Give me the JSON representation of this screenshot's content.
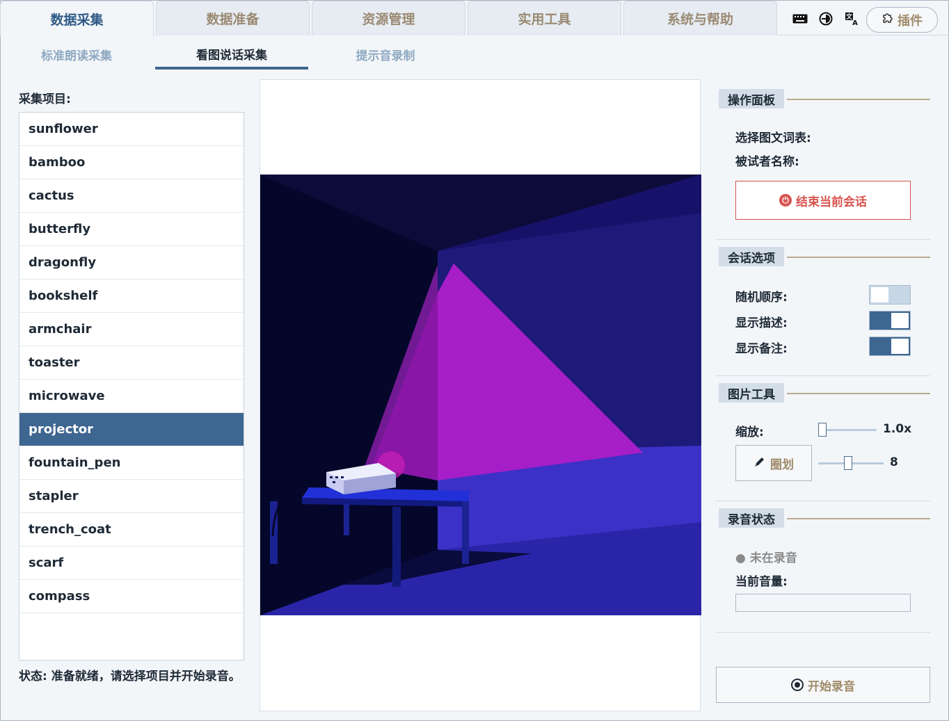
{
  "tabs": [
    {
      "label": "数据采集",
      "active": true
    },
    {
      "label": "数据准备",
      "active": false
    },
    {
      "label": "资源管理",
      "active": false
    },
    {
      "label": "实用工具",
      "active": false
    },
    {
      "label": "系统与帮助",
      "active": false
    }
  ],
  "toolbar": {
    "icons": [
      "keyboard-icon",
      "theme-icon",
      "translate-icon"
    ],
    "plugin_label": "插件"
  },
  "subtabs": [
    {
      "label": "标准朗读采集",
      "active": false
    },
    {
      "label": "看图说话采集",
      "active": true
    },
    {
      "label": "提示音录制",
      "active": false
    }
  ],
  "collection": {
    "title": "采集项目:",
    "items": [
      "sunflower",
      "bamboo",
      "cactus",
      "butterfly",
      "dragonfly",
      "bookshelf",
      "armchair",
      "toaster",
      "microwave",
      "projector",
      "fountain_pen",
      "stapler",
      "trench_coat",
      "scarf",
      "compass"
    ],
    "selected": "projector"
  },
  "status_text": "状态: 准备就绪，请选择项目并开始录音。",
  "operation_panel": {
    "title": "操作面板",
    "wordlist_label": "选择图文词表:",
    "subject_label": "被试者名称:",
    "end_session_label": "结束当前会话"
  },
  "session_options": {
    "title": "会话选项",
    "random_order": {
      "label": "随机顺序:",
      "on": false
    },
    "show_description": {
      "label": "显示描述:",
      "on": true
    },
    "show_notes": {
      "label": "显示备注:",
      "on": true
    }
  },
  "image_tools": {
    "title": "图片工具",
    "zoom_label": "缩放:",
    "zoom_value": "1.0x",
    "zoom_fraction": 0.0,
    "draw_label": "圈划",
    "brush_value": "8",
    "brush_fraction": 0.45
  },
  "recording": {
    "title": "录音状态",
    "state_text": "● 未在录音",
    "volume_label": "当前音量:",
    "volume_fraction": 0.0,
    "start_label": "开始录音"
  },
  "colors": {
    "accent": "#3d6690",
    "danger": "#d9534f",
    "muted_gold": "#a08b6a"
  }
}
